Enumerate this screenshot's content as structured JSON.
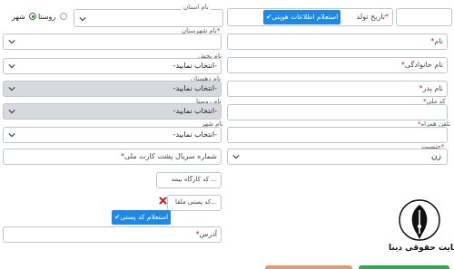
{
  "header": {
    "birthdate_label": "تاریخ تولد",
    "identity_button": "استعلام اطلاعات هویتی",
    "province_label": "نام استان",
    "settlement": {
      "city": "شهر",
      "village": "روستا",
      "selected": "city"
    }
  },
  "left": {
    "county": {
      "label": "نام شهرستان",
      "required": "*"
    },
    "district": {
      "label": "نام بخش",
      "value": "-انتخاب نمایید-"
    },
    "rural_district": {
      "label": "نام دهستان",
      "value": "-انتخاب نمایید-"
    },
    "village": {
      "label": "نام روستا",
      "value": "-انتخاب نمایید-"
    },
    "city": {
      "label": "نام شهر",
      "value": "-انتخاب نمایید-"
    },
    "card_serial": {
      "placeholder": "شماره سریال پشت کارت ملی",
      "required": "*"
    },
    "insurance_code": {
      "placeholder": "کد کارگاه بیمه ..."
    },
    "postal_code": {
      "placeholder": "کد پستی ملقا..."
    },
    "postal_button": "استعلام کد پستی",
    "address": {
      "placeholder": "آدرس",
      "required": "*"
    }
  },
  "right": {
    "first_name": {
      "placeholder": "نام",
      "required": "*"
    },
    "last_name": {
      "placeholder": "نام خانوادگی",
      "required": "*"
    },
    "father_name": {
      "placeholder": "نام پدر",
      "required": "*"
    },
    "national_code": {
      "label": "کد ملی",
      "required": "*"
    },
    "mobile": {
      "label": "تلفن همراه",
      "required": "*"
    },
    "gender": {
      "label": "جنسیت",
      "value": "زن",
      "required": "*"
    }
  },
  "watermark": {
    "text": "سایت حقوقی دینا"
  },
  "colors": {
    "accent_blue": "#1e88e5",
    "required_red": "#d7141b",
    "gray_field": "#d6d9dd",
    "border": "#bfc5cc",
    "radio_green": "#2e7d32",
    "bottom_orange": "#e69a6b",
    "bottom_green": "#2eaa4a"
  },
  "icons": {
    "chevron": "chevron-down-icon",
    "check": "check-icon",
    "close": "close-icon",
    "logo": "quill-logo-icon"
  }
}
